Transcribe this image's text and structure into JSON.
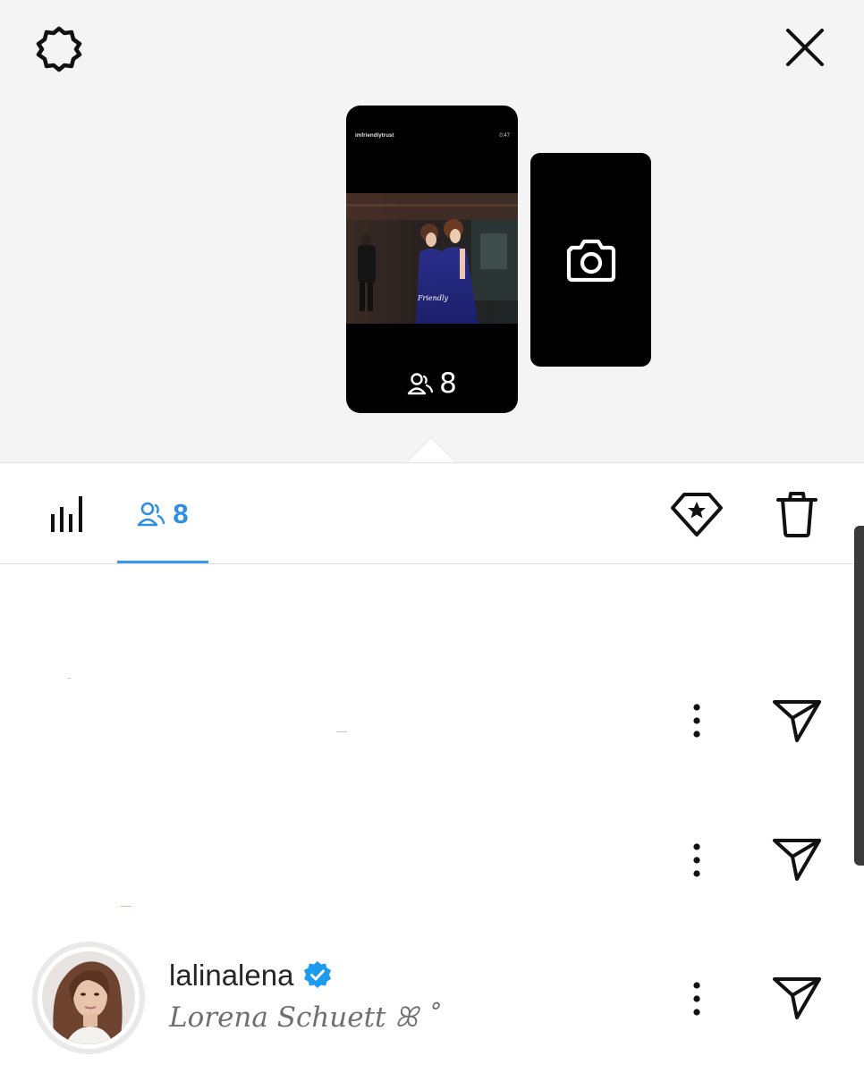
{
  "header": {
    "settings_icon": "gear-icon",
    "close_icon": "close-icon"
  },
  "story": {
    "username": "imfriendlytrust",
    "time": "0:47",
    "video_caption": "Friendly",
    "viewer_count": "8"
  },
  "camera_card": {
    "icon": "camera-icon"
  },
  "tabs": {
    "insights_icon": "bar-chart-icon",
    "viewers_icon": "viewers-icon",
    "viewers_count": "8",
    "active": "viewers"
  },
  "actions": {
    "highlight_icon": "diamond-star-icon",
    "delete_icon": "trash-icon"
  },
  "viewers": [
    {
      "username": "",
      "full_name": ""
    },
    {
      "username": "",
      "full_name": ""
    },
    {
      "username": "lalinalena",
      "verified": true,
      "full_name": "Lorena Schuett ꕤ ˚"
    }
  ],
  "colors": {
    "accent": "#3897f0",
    "verified": "#1d9bf0",
    "top_bg": "#f4f4f4",
    "card_bg": "#000000"
  }
}
